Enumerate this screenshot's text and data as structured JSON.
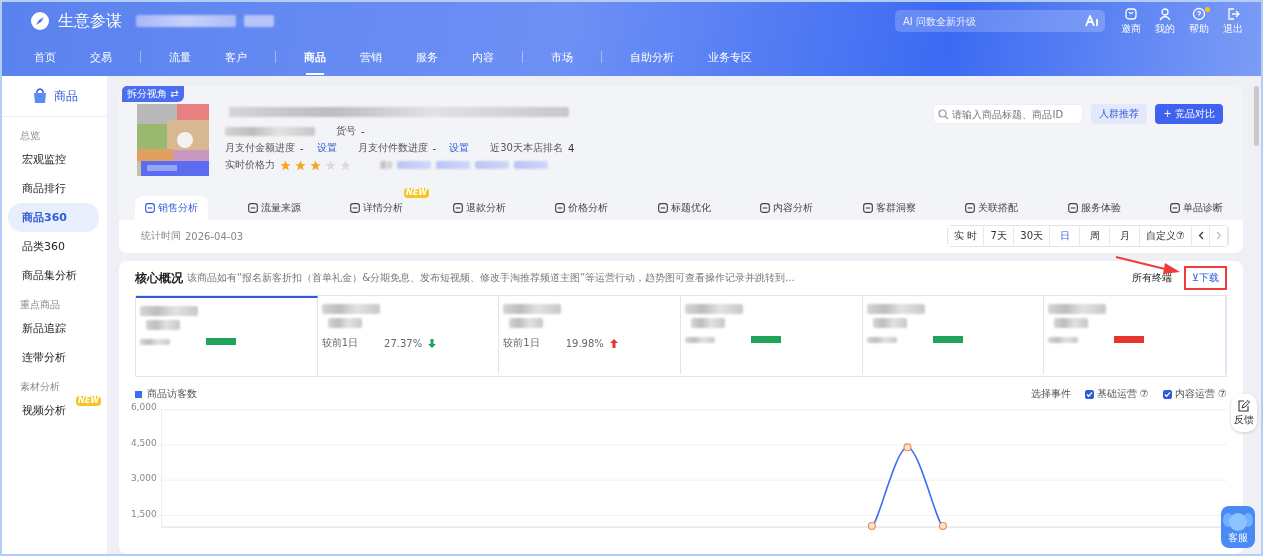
{
  "header": {
    "brand": "生意参谋",
    "ai_search": {
      "placeholder": "AI 问数全新升级"
    },
    "actions": [
      {
        "kind": "shop",
        "label": "邀商"
      },
      {
        "kind": "user",
        "label": "我的"
      },
      {
        "kind": "help",
        "label": "帮助",
        "dot": true
      },
      {
        "kind": "logout",
        "label": "退出"
      }
    ],
    "nav": [
      [
        {
          "label": "首页",
          "selected": false
        },
        {
          "label": "交易",
          "selected": false
        }
      ],
      [
        {
          "label": "流量",
          "selected": false
        },
        {
          "label": "客户",
          "selected": false
        }
      ],
      [
        {
          "label": "商品",
          "selected": true
        },
        {
          "label": "营销",
          "selected": false
        },
        {
          "label": "服务",
          "selected": false
        },
        {
          "label": "内容",
          "selected": false
        }
      ],
      [
        {
          "label": "市场",
          "selected": false
        }
      ],
      [
        {
          "label": "自助分析",
          "selected": false
        },
        {
          "label": "业务专区",
          "selected": false
        }
      ]
    ]
  },
  "sidebar": {
    "title": "商品",
    "items": [
      {
        "kind": "group",
        "label": "总览"
      },
      {
        "kind": "item",
        "label": "宏观监控",
        "selected": false
      },
      {
        "kind": "item",
        "label": "商品排行",
        "selected": false
      },
      {
        "kind": "item",
        "label": "商品360",
        "selected": true
      },
      {
        "kind": "item",
        "label": "品类360",
        "selected": false
      },
      {
        "kind": "item",
        "label": "商品集分析",
        "selected": false
      },
      {
        "kind": "group",
        "label": "重点商品"
      },
      {
        "kind": "item",
        "label": "新品追踪",
        "selected": false
      },
      {
        "kind": "item",
        "label": "连带分析",
        "selected": false
      },
      {
        "kind": "group",
        "label": "素材分析"
      },
      {
        "kind": "item",
        "label": "视频分析",
        "selected": false,
        "badge": "NEW"
      }
    ]
  },
  "product": {
    "view_badge": "拆分视角 ⇄",
    "sku_label": "货号",
    "sku_value": "-",
    "progress": [
      {
        "label": "月支付金额进度",
        "value": "-",
        "link": "设置"
      },
      {
        "label": "月支付件数进度",
        "value": "-",
        "link": "设置"
      }
    ],
    "rank": {
      "label": "近30天本店排名",
      "value": "4"
    },
    "price_power": {
      "label": "实时价格力",
      "stars": 3
    },
    "search": {
      "placeholder": "请输入商品标题、商品ID"
    },
    "buttons": [
      {
        "kind": "secondary",
        "label": "人群推荐"
      },
      {
        "kind": "primary",
        "label": "+ 竞品对比"
      }
    ]
  },
  "tabs": [
    {
      "label": "销售分析",
      "selected": true
    },
    {
      "label": "流量来源",
      "selected": false
    },
    {
      "label": "详情分析",
      "selected": false,
      "badge": "NEW"
    },
    {
      "label": "退款分析",
      "selected": false
    },
    {
      "label": "价格分析",
      "selected": false
    },
    {
      "label": "标题优化",
      "selected": false
    },
    {
      "label": "内容分析",
      "selected": false
    },
    {
      "label": "客群洞察",
      "selected": false
    },
    {
      "label": "关联搭配",
      "selected": false
    },
    {
      "label": "服务体验",
      "selected": false
    },
    {
      "label": "单品诊断",
      "selected": false
    }
  ],
  "stat_time": {
    "label": "统计时间",
    "value": "2026-04-03"
  },
  "periods": [
    {
      "label": "实 时",
      "selected": false
    },
    {
      "label": "7天",
      "selected": false
    },
    {
      "label": "30天",
      "selected": false
    },
    {
      "label": "日",
      "selected": true
    },
    {
      "label": "周",
      "selected": false
    },
    {
      "label": "月",
      "selected": false
    },
    {
      "label": "自定义⑦",
      "selected": false
    }
  ],
  "core": {
    "title": "核心概况",
    "description": "该商品如有“报名新客折扣（首单礼金）&分期免息、发布短视频、修改手淘推荐频道主图”等运营行动，趋势图可查看操作记录并跳转到...",
    "terminal": "所有终端",
    "download": "⊻下载",
    "metrics": [
      {
        "selected": true,
        "color": "#1fa45a"
      },
      {
        "selected": false,
        "color": "#1fa45a",
        "compare_label": "较前1日",
        "change": "27.37%"
      },
      {
        "selected": false,
        "color": "#e8342f",
        "compare_label": "较前1日",
        "change": "19.98%"
      },
      {
        "selected": false,
        "color": "#1fa45a"
      },
      {
        "selected": false,
        "color": "#1fa45a"
      },
      {
        "selected": false,
        "color": "#e8342f"
      }
    ],
    "event_label": "选择事件",
    "events": [
      {
        "label": "基础运营 ⑦",
        "checked": true
      },
      {
        "label": "内容运营 ⑦",
        "checked": true
      }
    ],
    "chart_data": {
      "type": "line",
      "grid": true,
      "ylim": [
        1000,
        6000
      ],
      "yticks": [
        {
          "value": 6000,
          "label": "6,000"
        },
        {
          "value": 4500,
          "label": "4,500"
        },
        {
          "value": 3000,
          "label": "3,000"
        },
        {
          "value": 1500,
          "label": "1,500"
        }
      ],
      "series": [
        {
          "name": "商品访客数",
          "color": "#3a6ff0",
          "marker": "circle",
          "values": [
            null,
            null,
            null,
            null,
            null,
            null,
            null,
            null,
            null,
            null,
            null,
            null,
            null,
            null,
            null,
            null,
            null,
            null,
            null,
            null,
            1050,
            4400,
            1050,
            null,
            null,
            null,
            null,
            null,
            null,
            null,
            null
          ]
        }
      ]
    }
  },
  "float": {
    "feedback": "反馈",
    "service": "客服"
  }
}
